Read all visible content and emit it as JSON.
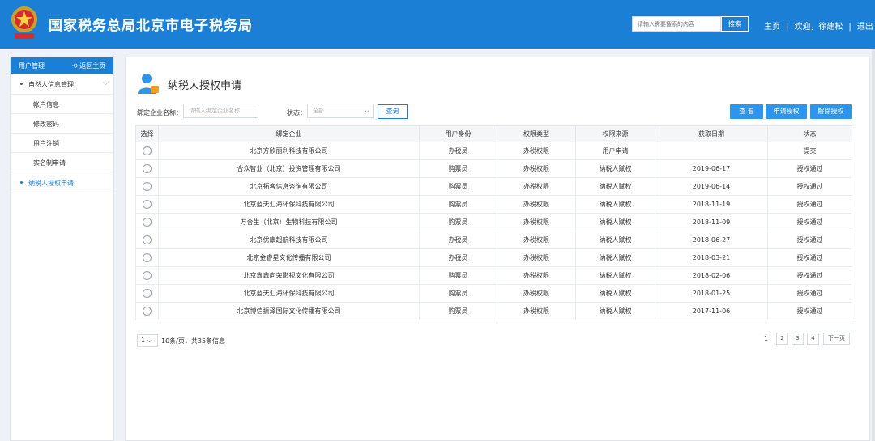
{
  "header": {
    "site_title": "国家税务总局北京市电子税务局",
    "search_placeholder": "请输入需要搜索的内容",
    "search_button": "搜索",
    "nav": {
      "home": "主页",
      "welcome": "欢迎，徐建松",
      "logout": "退出"
    }
  },
  "sidebar": {
    "title": "用户管理",
    "back": "返回主页",
    "group": "自然人信息管理",
    "subitems": [
      "帐户信息",
      "修改密码",
      "用户注销",
      "实名制申请"
    ],
    "active_item": "纳税人授权申请"
  },
  "main": {
    "title": "纳税人授权申请",
    "filters": {
      "company_label": "绑定企业名称：",
      "company_placeholder": "请输入绑定企业名称",
      "status_label": "状态：",
      "status_value": "全部",
      "query_button": "查询"
    },
    "actions": [
      "查 看",
      "申请授权",
      "解除授权"
    ],
    "table": {
      "headers": [
        "选择",
        "绑定企业",
        "用户身份",
        "权限类型",
        "权限来源",
        "获取日期",
        "状态"
      ],
      "rows": [
        [
          "北京方欣丽利科技有限公司",
          "办税员",
          "办税权限",
          "用户申请",
          "",
          "提交"
        ],
        [
          "合众智业（北京）投资管理有限公司",
          "购票员",
          "办税权限",
          "纳税人赋权",
          "2019-06-17",
          "授权通过"
        ],
        [
          "北京拓客信息咨询有限公司",
          "购票员",
          "办税权限",
          "纳税人赋权",
          "2019-06-14",
          "授权通过"
        ],
        [
          "北京蓝天汇海环保科技有限公司",
          "购票员",
          "办税权限",
          "纳税人赋权",
          "2018-11-19",
          "授权通过"
        ],
        [
          "万合生（北京）生物科技有限公司",
          "购票员",
          "办税权限",
          "纳税人赋权",
          "2018-11-09",
          "授权通过"
        ],
        [
          "北京优康起航科技有限公司",
          "办税员",
          "办税权限",
          "纳税人赋权",
          "2018-06-27",
          "授权通过"
        ],
        [
          "北京金睿星文化传播有限公司",
          "办税员",
          "办税权限",
          "纳税人赋权",
          "2018-03-21",
          "授权通过"
        ],
        [
          "北京鑫鑫向荣影视文化有限公司",
          "购票员",
          "办税权限",
          "纳税人赋权",
          "2018-02-06",
          "授权通过"
        ],
        [
          "北京蓝天汇海环保科技有限公司",
          "购票员",
          "办税权限",
          "纳税人赋权",
          "2018-01-25",
          "授权通过"
        ],
        [
          "北京博信振泽国际文化传播有限公司",
          "购票员",
          "办税权限",
          "纳税人赋权",
          "2017-11-06",
          "授权通过"
        ]
      ]
    },
    "pagination": {
      "per_page": "1",
      "info": "10条/页，共35条信息",
      "current": "1",
      "pages": [
        "2",
        "3",
        "4"
      ],
      "next": "下一页"
    }
  },
  "colors": {
    "primary": "#1b7fd6",
    "button": "#2c95f0"
  }
}
